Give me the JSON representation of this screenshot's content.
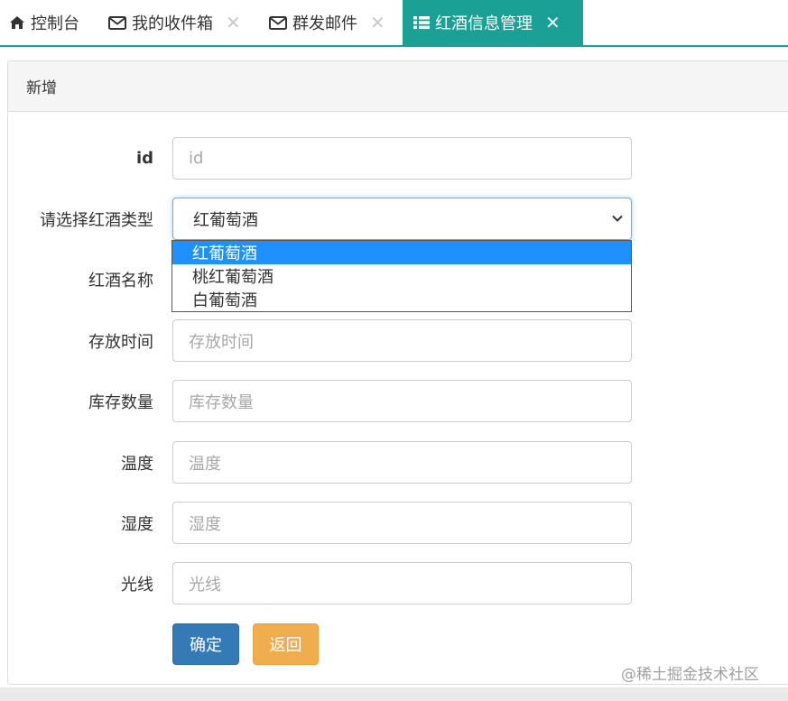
{
  "tabs": [
    {
      "label": "控制台",
      "icon": "home-icon",
      "closable": false
    },
    {
      "label": "我的收件箱",
      "icon": "envelope-icon",
      "closable": true
    },
    {
      "label": "群发邮件",
      "icon": "envelope-icon",
      "closable": true
    },
    {
      "label": "红酒信息管理",
      "icon": "list-icon",
      "closable": true,
      "active": true
    }
  ],
  "close_glyph": "✕",
  "panel": {
    "heading": "新增"
  },
  "form": {
    "id": {
      "label": "id",
      "placeholder": "id"
    },
    "wine_type": {
      "label": "请选择红酒类型",
      "value": "红葡萄酒",
      "options": [
        "红葡萄酒",
        "桃红葡萄酒",
        "白葡萄酒"
      ]
    },
    "wine_name": {
      "label": "红酒名称"
    },
    "storage_time": {
      "label": "存放时间",
      "placeholder": "存放时间"
    },
    "stock": {
      "label": "库存数量",
      "placeholder": "库存数量"
    },
    "temperature": {
      "label": "温度",
      "placeholder": "温度"
    },
    "humidity": {
      "label": "湿度",
      "placeholder": "湿度"
    },
    "light": {
      "label": "光线",
      "placeholder": "光线"
    }
  },
  "buttons": {
    "confirm": "确定",
    "back": "返回"
  },
  "watermark": "@稀土掘金技术社区",
  "colors": {
    "accent": "#1aa094",
    "primary": "#337ab7",
    "warning": "#f0ad4e",
    "option_highlight": "#1e90ff"
  }
}
